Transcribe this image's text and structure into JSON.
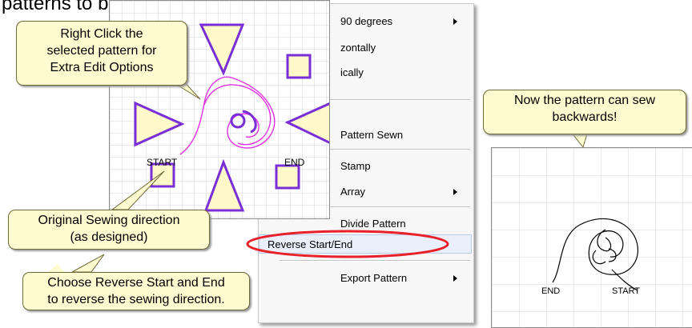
{
  "heading": "patterns to be sewn backwards.",
  "menu": {
    "items": [
      {
        "label": "90 degrees",
        "submenu": true
      },
      {
        "label": "zontally",
        "submenu": false
      },
      {
        "label": "ically",
        "submenu": false
      },
      {
        "label": "Pattern Sewn",
        "submenu": false
      },
      {
        "label": "Stamp",
        "submenu": false
      },
      {
        "label": "Array",
        "submenu": true
      },
      {
        "label": "Divide Pattern",
        "submenu": false
      },
      {
        "label": "Reverse Start/End",
        "submenu": false,
        "highlighted": true
      },
      {
        "label": "Export Pattern",
        "submenu": true
      }
    ],
    "highlight_color": "#e8202a"
  },
  "left_panel": {
    "start_label": "START",
    "end_label": "END",
    "pattern_color": "#7a2fd6",
    "fill_color": "#fff8c8",
    "curve_color": "#e030e0"
  },
  "right_panel": {
    "end_label": "END",
    "start_label": "START"
  },
  "callouts": {
    "right_click": [
      "Right Click the",
      "selected pattern for",
      "Extra Edit Options"
    ],
    "original": [
      "Original Sewing direction",
      "(as designed)"
    ],
    "choose": [
      "Choose Reverse Start and End",
      "to reverse the sewing direction."
    ],
    "now": [
      "Now the pattern can sew",
      "backwards!"
    ]
  }
}
